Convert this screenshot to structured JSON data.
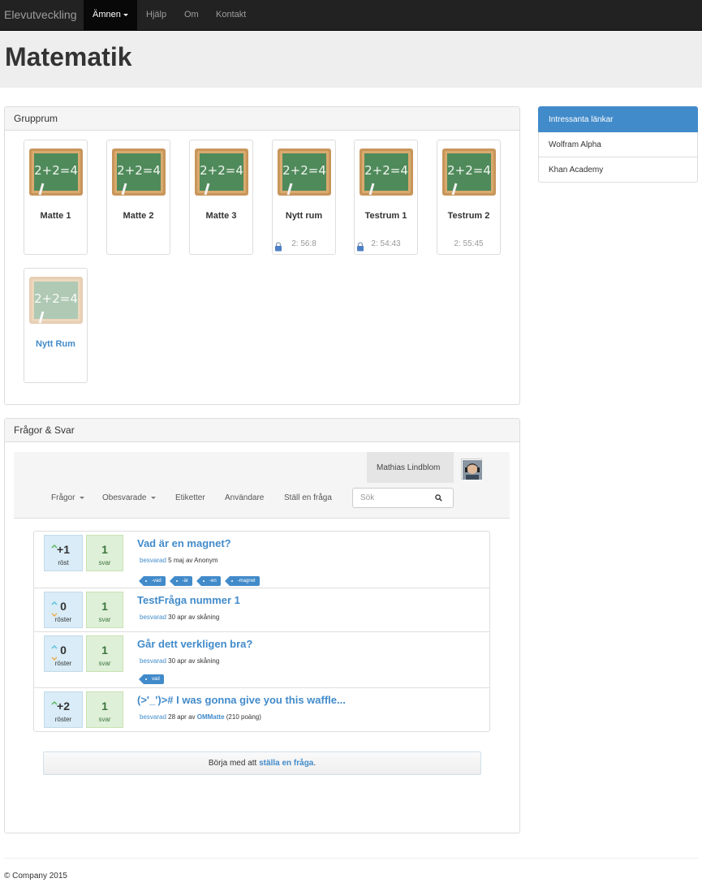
{
  "navbar": {
    "brand": "Elevutveckling",
    "active_item": "Ämnen",
    "items": [
      "Hjälp",
      "Om",
      "Kontakt"
    ]
  },
  "page_title": "Matematik",
  "grupprum": {
    "heading": "Grupprum",
    "rooms": [
      {
        "name": "Matte 1",
        "time": "",
        "locked": false
      },
      {
        "name": "Matte 2",
        "time": "",
        "locked": false
      },
      {
        "name": "Matte 3",
        "time": "",
        "locked": false
      },
      {
        "name": "Nytt rum",
        "time": "2: 56:8",
        "locked": true
      },
      {
        "name": "Testrum 1",
        "time": "2: 54:43",
        "locked": true
      },
      {
        "name": "Testrum 2",
        "time": "2: 55:45",
        "locked": false
      },
      {
        "name": "Nytt Rum",
        "time": "",
        "locked": false,
        "new": true
      }
    ]
  },
  "sidebar": {
    "heading": "Intressanta länkar",
    "links": [
      "Wolfram Alpha",
      "Khan Academy"
    ]
  },
  "qa": {
    "heading": "Frågor & Svar",
    "user": "Mathias Lindblom",
    "menu": [
      "Frågor",
      "Obesvarade",
      "Etiketter",
      "Användare",
      "Ställ en fråga"
    ],
    "search_placeholder": "Sök",
    "questions": [
      {
        "votes": "+1",
        "votes_label": "röst",
        "answers": "1",
        "answers_label": "svar",
        "title": "Vad är en magnet?",
        "status": "besvarad",
        "meta": "5 maj av Anonym",
        "tags": [
          "-vad",
          "-är",
          "-en",
          "-magnet"
        ]
      },
      {
        "votes": "0",
        "votes_label": "röster",
        "answers": "1",
        "answers_label": "svar",
        "title": "TestFråga nummer 1",
        "status": "besvarad",
        "meta": "30 apr av skåning",
        "tags": []
      },
      {
        "votes": "0",
        "votes_label": "röster",
        "answers": "1",
        "answers_label": "svar",
        "title": "Går dett verkligen bra?",
        "status": "besvarad",
        "meta": "30 apr av skåning",
        "tags": [
          "vad"
        ]
      },
      {
        "votes": "+2",
        "votes_label": "röster",
        "answers": "1",
        "answers_label": "svar",
        "title": "(>'_')># I was gonna give you this waffle...",
        "status": "besvarad",
        "meta": "28 apr av",
        "author": "OMMatte",
        "points": "(210 poäng)",
        "tags": []
      }
    ],
    "cta_text": "Börja med att",
    "cta_link": "ställa en fråga",
    "cta_end": "."
  },
  "footer": "© Company 2015",
  "colors": {
    "primary": "#428bca",
    "navbar": "#222222",
    "vote_bg": "#d9ecf7",
    "answer_bg": "#dff0d8"
  }
}
